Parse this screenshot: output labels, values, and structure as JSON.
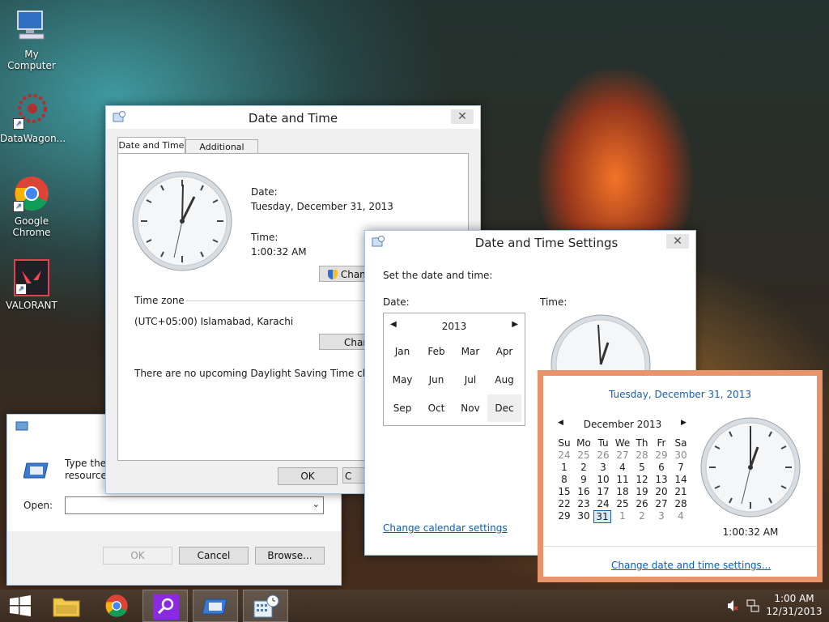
{
  "desktop": {
    "icons": [
      {
        "label": "My Computer"
      },
      {
        "label": "DataWagon..."
      },
      {
        "label": "Google Chrome"
      },
      {
        "label": "VALORANT"
      }
    ]
  },
  "date_time_dialog": {
    "title": "Date and Time",
    "tabs": [
      "Date and Time",
      "Additional Clocks"
    ],
    "date_label": "Date:",
    "date_value": "Tuesday, December 31, 2013",
    "time_label": "Time:",
    "time_value": "1:00:32 AM",
    "change_datetime_btn": "Chan",
    "timezone_heading": "Time zone",
    "timezone_value": "(UTC+05:00) Islamabad, Karachi",
    "change_tz_btn": "Char",
    "dst_text": "There are no upcoming Daylight Saving Time changes",
    "ok": "OK",
    "cancel_partial": "C"
  },
  "settings_dialog": {
    "title": "Date and Time Settings",
    "prompt": "Set the date and time:",
    "date_label": "Date:",
    "time_label": "Time:",
    "year": "2013",
    "months": [
      "Jan",
      "Feb",
      "Mar",
      "Apr",
      "May",
      "Jun",
      "Jul",
      "Aug",
      "Sep",
      "Oct",
      "Nov",
      "Dec"
    ],
    "selected_month": "Dec",
    "calendar_link": "Change calendar settings"
  },
  "run_dialog": {
    "description_line1": "Type the n",
    "description_line2": "resource,",
    "open_label": "Open:",
    "open_value": "",
    "ok": "OK",
    "cancel": "Cancel",
    "browse": "Browse..."
  },
  "flyout": {
    "date_heading": "Tuesday, December 31, 2013",
    "month_title": "December 2013",
    "weekdays": [
      "Su",
      "Mo",
      "Tu",
      "We",
      "Th",
      "Fr",
      "Sa"
    ],
    "weeks": [
      [
        "24",
        "25",
        "26",
        "27",
        "28",
        "29",
        "30"
      ],
      [
        "1",
        "2",
        "3",
        "4",
        "5",
        "6",
        "7"
      ],
      [
        "8",
        "9",
        "10",
        "11",
        "12",
        "13",
        "14"
      ],
      [
        "15",
        "16",
        "17",
        "18",
        "19",
        "20",
        "21"
      ],
      [
        "22",
        "23",
        "24",
        "25",
        "26",
        "27",
        "28"
      ],
      [
        "29",
        "30",
        "31",
        "1",
        "2",
        "3",
        "4"
      ]
    ],
    "selected_day": "31",
    "time_value": "1:00:32 AM",
    "settings_link": "Change date and time settings..."
  },
  "taskbar": {
    "clock_time": "1:00 AM",
    "clock_date": "12/31/2013"
  },
  "colors": {
    "accent_link": "#0b5db3",
    "flyout_border": "#e8936a",
    "search_tile": "#8a2be2"
  }
}
